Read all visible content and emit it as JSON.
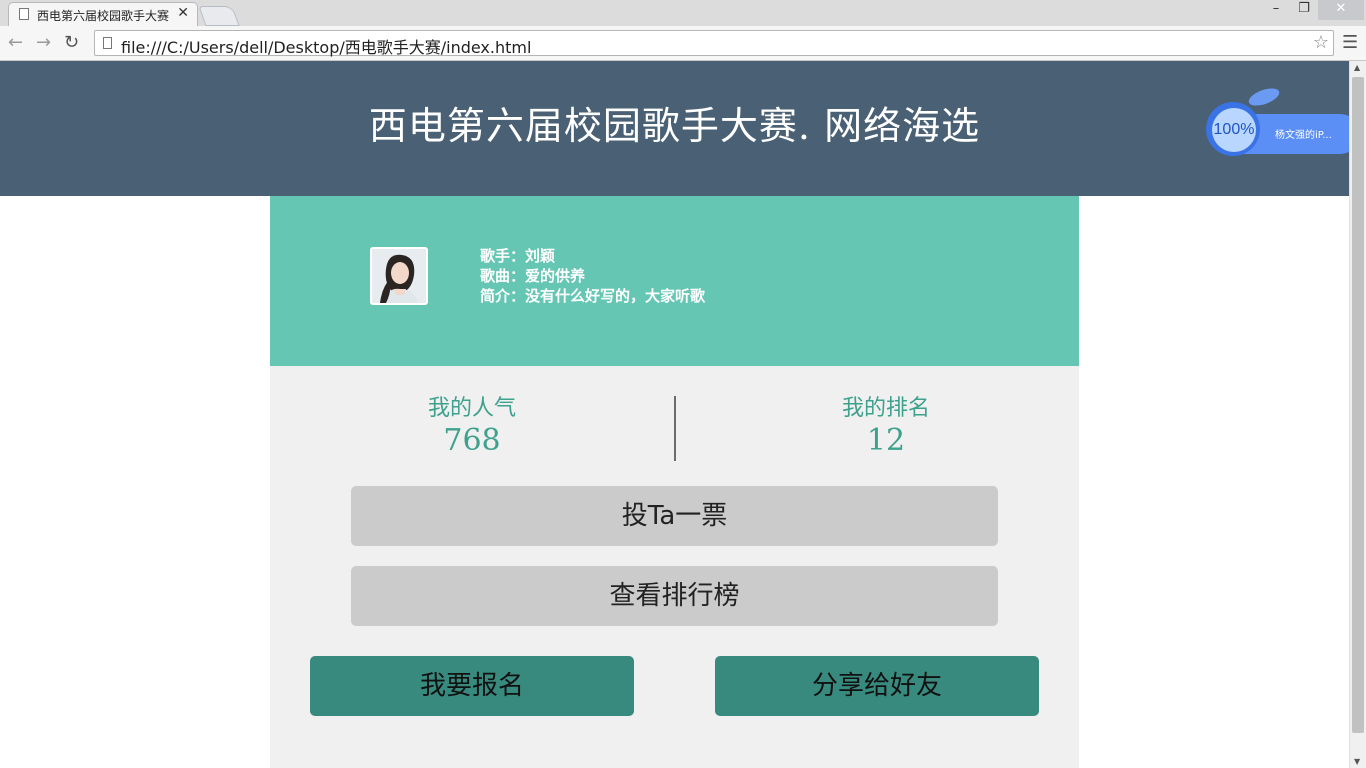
{
  "browser": {
    "tab_title": "西电第六届校园歌手大赛",
    "tab_close": "✕",
    "url": "file:///C:/Users/dell/Desktop/西电歌手大赛/index.html",
    "window_min": "–",
    "window_restore": "❐",
    "window_close": "✕"
  },
  "header": {
    "title": "西电第六届校园歌手大赛. 网络海选"
  },
  "widget": {
    "percent": "100%",
    "label": "杨文强的iP..."
  },
  "singer": {
    "name_line": "歌手：刘颖",
    "song_line": "歌曲：爱的供养",
    "intro_line": "简介：没有什么好写的，大家听歌"
  },
  "stats": {
    "popularity_label": "我的人气",
    "popularity_value": "768",
    "rank_label": "我的排名",
    "rank_value": "12"
  },
  "buttons": {
    "vote": "投Ta一票",
    "leaderboard": "查看排行榜",
    "signup": "我要报名",
    "share": "分享给好友"
  },
  "colors": {
    "header_bg": "#4a6075",
    "green_panel": "#65c6b4",
    "accent_text": "#3ea18d",
    "teal_button": "#388a7e"
  }
}
